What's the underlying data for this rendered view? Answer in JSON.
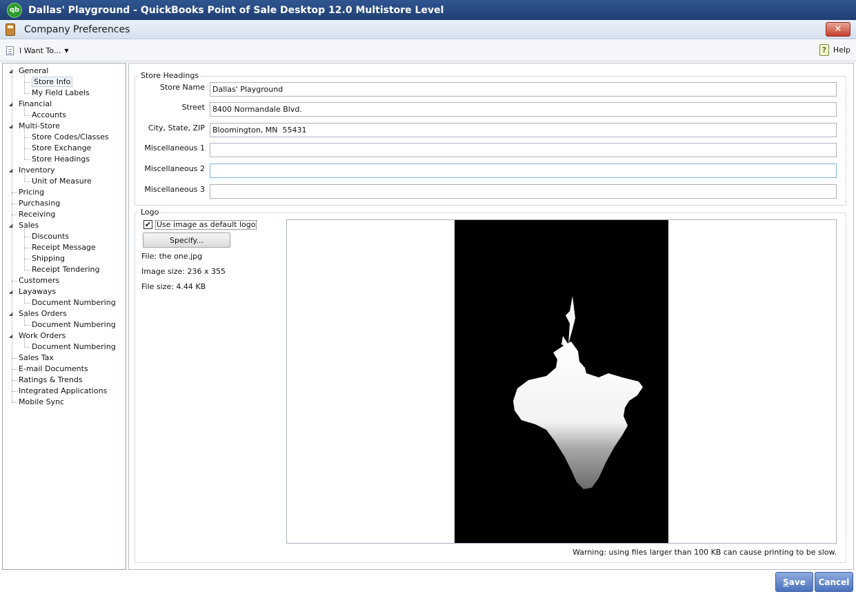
{
  "app": {
    "title": "Dallas' Playground - QuickBooks Point of Sale Desktop 12.0 Multistore Level",
    "logo_text": "qb"
  },
  "window": {
    "title": "Company Preferences",
    "close_label": "✕"
  },
  "toolbar": {
    "i_want_to": "I Want To...",
    "dropdown_glyph": "▼",
    "help": "Help",
    "help_glyph": "?"
  },
  "tree": {
    "expand_glyph": "◢",
    "items": [
      {
        "label": "General",
        "level": 0,
        "expandable": true
      },
      {
        "label": "Store Info",
        "level": 1,
        "selected": true
      },
      {
        "label": "My Field Labels",
        "level": 1
      },
      {
        "label": "Financial",
        "level": 0,
        "expandable": true
      },
      {
        "label": "Accounts",
        "level": 1
      },
      {
        "label": "Multi-Store",
        "level": 0,
        "expandable": true
      },
      {
        "label": "Store Codes/Classes",
        "level": 1
      },
      {
        "label": "Store Exchange",
        "level": 1
      },
      {
        "label": "Store Headings",
        "level": 1
      },
      {
        "label": "Inventory",
        "level": 0,
        "expandable": true
      },
      {
        "label": "Unit of Measure",
        "level": 1
      },
      {
        "label": "Pricing",
        "level": 0
      },
      {
        "label": "Purchasing",
        "level": 0
      },
      {
        "label": "Receiving",
        "level": 0
      },
      {
        "label": "Sales",
        "level": 0,
        "expandable": true
      },
      {
        "label": "Discounts",
        "level": 1
      },
      {
        "label": "Receipt Message",
        "level": 1
      },
      {
        "label": "Shipping",
        "level": 1
      },
      {
        "label": "Receipt Tendering",
        "level": 1
      },
      {
        "label": "Customers",
        "level": 0
      },
      {
        "label": "Layaways",
        "level": 0,
        "expandable": true
      },
      {
        "label": "Document Numbering",
        "level": 1
      },
      {
        "label": "Sales Orders",
        "level": 0,
        "expandable": true
      },
      {
        "label": "Document Numbering",
        "level": 1
      },
      {
        "label": "Work Orders",
        "level": 0,
        "expandable": true
      },
      {
        "label": "Document Numbering",
        "level": 1
      },
      {
        "label": "Sales Tax",
        "level": 0
      },
      {
        "label": "E-mail Documents",
        "level": 0
      },
      {
        "label": "Ratings & Trends",
        "level": 0
      },
      {
        "label": "Integrated Applications",
        "level": 0
      },
      {
        "label": "Mobile Sync",
        "level": 0
      }
    ]
  },
  "store_headings": {
    "title": "Store Headings",
    "fields": [
      {
        "label": "Store Name",
        "value": "Dallas' Playground"
      },
      {
        "label": "Street",
        "value": "8400 Normandale Blvd."
      },
      {
        "label": "City, State, ZIP",
        "value": "Bloomington, MN  55431"
      },
      {
        "label": "Miscellaneous 1",
        "value": ""
      },
      {
        "label": "Miscellaneous 2",
        "value": ""
      },
      {
        "label": "Miscellaneous 3",
        "value": ""
      }
    ]
  },
  "logo": {
    "title": "Logo",
    "use_default_label": "Use image as default logo",
    "use_default_checked": true,
    "check_glyph": "✔",
    "specify_label": "Specify...",
    "file": "File: the one.jpg",
    "image_size": "Image size: 236 x 355",
    "file_size": "File size: 4.44 KB",
    "warning": "Warning: using files larger than 100 KB can cause printing to be slow."
  },
  "buttons": {
    "save_first": "S",
    "save_rest": "ave",
    "cancel": "Cancel"
  },
  "colors": {
    "title_bar": "#203f74",
    "button_blue": "#4c72bd",
    "close_red": "#c7402a"
  }
}
